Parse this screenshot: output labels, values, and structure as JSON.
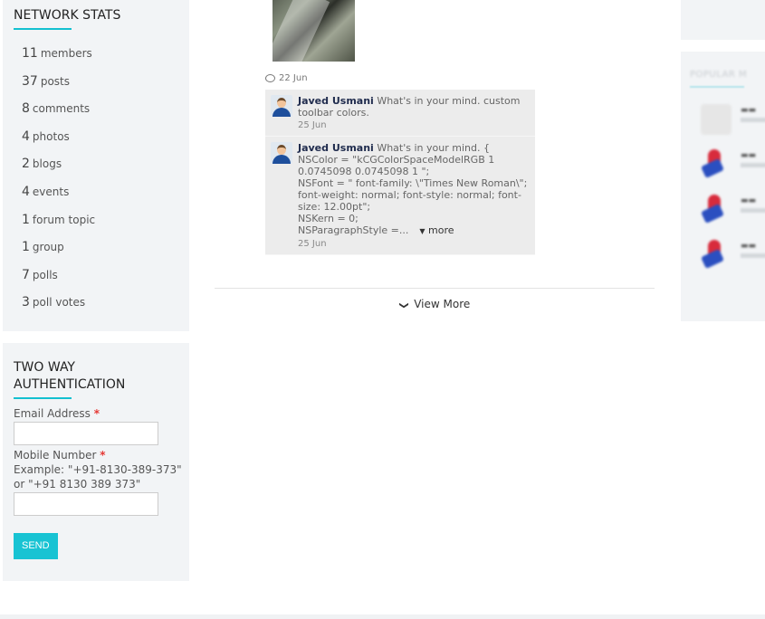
{
  "network_stats": {
    "title": "NETWORK STATS",
    "items": [
      {
        "count": "11",
        "label": "members"
      },
      {
        "count": "37",
        "label": "posts"
      },
      {
        "count": "8",
        "label": "comments"
      },
      {
        "count": "4",
        "label": "photos"
      },
      {
        "count": "2",
        "label": "blogs"
      },
      {
        "count": "4",
        "label": "events"
      },
      {
        "count": "1",
        "label": "forum topic"
      },
      {
        "count": "1",
        "label": "group"
      },
      {
        "count": "7",
        "label": "polls"
      },
      {
        "count": "3",
        "label": "poll votes"
      }
    ]
  },
  "two_way_auth": {
    "title": "TWO WAY AUTHENTICATION",
    "email_label": "Email Address",
    "mobile_label": "Mobile Number",
    "required_mark": "*",
    "mobile_hint": "Example: \"+91-8130-389-373\" or \"+91 8130 389 373\"",
    "email_value": "",
    "mobile_value": "",
    "send_label": "SEND"
  },
  "feed": {
    "post_date": "22 Jun",
    "comments": [
      {
        "author": "Javed Usmani",
        "text": "What's in your mind. custom toolbar colors.",
        "date": "25 Jun"
      },
      {
        "author": "Javed Usmani",
        "text_lines": [
          "What's in your mind. {",
          "NSColor = \"kCGColorSpaceModelRGB 1 0.0745098 0.0745098 1 \";",
          "NSFont = \" font-family: \\\"Times New Roman\\\"; font-weight: normal; font-style: normal; font-size: 12.00pt\";",
          "NSKern = 0;",
          "NSParagraphStyle =..."
        ],
        "more_label": "more",
        "date": "25 Jun"
      }
    ],
    "view_more_label": "View More"
  },
  "popular_members": {
    "title": "POPULAR M"
  },
  "icons": {
    "comment": "comment-icon",
    "more_caret": "caret-down-icon",
    "view_more": "chevron-down-icon"
  },
  "colors": {
    "accent": "#18c3d3",
    "panel_bg": "#f2f4f6",
    "required": "#e53935",
    "author": "#1f2b4d"
  }
}
